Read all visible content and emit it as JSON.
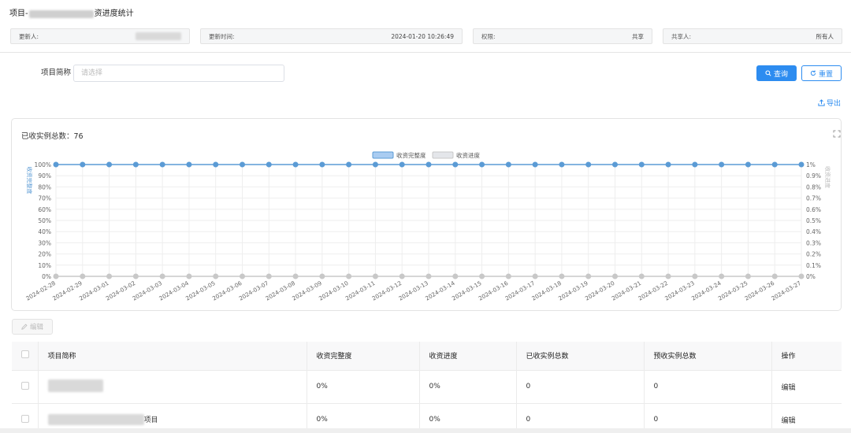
{
  "header": {
    "title_prefix": "项目-",
    "title_suffix": "资进度统计",
    "info": [
      {
        "label": "更新人:",
        "value": ""
      },
      {
        "label": "更新时间:",
        "value": "2024-01-20 10:26:49"
      },
      {
        "label": "权限:",
        "value": "共享"
      },
      {
        "label": "共享人:",
        "value": "所有人"
      }
    ]
  },
  "filter": {
    "label": "项目简称",
    "placeholder": "请选择",
    "query_label": "查询",
    "reset_label": "重置",
    "export_label": "导出"
  },
  "chart_summary": {
    "label": "已收实例总数：",
    "value": "76"
  },
  "edit_label": "编辑",
  "table": {
    "headers": [
      "项目简称",
      "收资完整度",
      "收资进度",
      "已收实例总数",
      "预收实例总数",
      "操作"
    ],
    "rows": [
      {
        "name_suffix": "",
        "completeness": "0%",
        "progress": "0%",
        "received": "0",
        "expected": "0",
        "action": "编辑"
      },
      {
        "name_suffix": "项目",
        "completeness": "0%",
        "progress": "0%",
        "received": "0",
        "expected": "0",
        "action": "编辑"
      }
    ]
  },
  "colors": {
    "accent": "#2d8cf0",
    "series1": "#5b9bd5",
    "series2": "#c8c8c8"
  },
  "chart_data": {
    "type": "line",
    "x": [
      "2024-02-28",
      "2024-02-29",
      "2024-03-01",
      "2024-03-02",
      "2024-03-03",
      "2024-03-04",
      "2024-03-05",
      "2024-03-06",
      "2024-03-07",
      "2024-03-08",
      "2024-03-09",
      "2024-03-10",
      "2024-03-11",
      "2024-03-12",
      "2024-03-13",
      "2024-03-14",
      "2024-03-15",
      "2024-03-16",
      "2024-03-17",
      "2024-03-18",
      "2024-03-19",
      "2024-03-20",
      "2024-03-21",
      "2024-03-22",
      "2024-03-23",
      "2024-03-24",
      "2024-03-25",
      "2024-03-26",
      "2024-03-27"
    ],
    "series": [
      {
        "name": "收资完整度",
        "axis": "left",
        "values": [
          100,
          100,
          100,
          100,
          100,
          100,
          100,
          100,
          100,
          100,
          100,
          100,
          100,
          100,
          100,
          100,
          100,
          100,
          100,
          100,
          100,
          100,
          100,
          100,
          100,
          100,
          100,
          100,
          100
        ]
      },
      {
        "name": "收资进度",
        "axis": "right",
        "values": [
          0,
          0,
          0,
          0,
          0,
          0,
          0,
          0,
          0,
          0,
          0,
          0,
          0,
          0,
          0,
          0,
          0,
          0,
          0,
          0,
          0,
          0,
          0,
          0,
          0,
          0,
          0,
          0,
          0
        ]
      }
    ],
    "ylabel_left": "收资完整度",
    "ylabel_right": "收资进度",
    "yticks_left": [
      "0%",
      "10%",
      "20%",
      "30%",
      "40%",
      "50%",
      "60%",
      "70%",
      "80%",
      "90%",
      "100%"
    ],
    "yticks_right": [
      "0%",
      "0.1%",
      "0.2%",
      "0.3%",
      "0.4%",
      "0.5%",
      "0.6%",
      "0.7%",
      "0.8%",
      "0.9%",
      "1%"
    ],
    "ylim_left": [
      0,
      100
    ],
    "ylim_right": [
      0,
      1
    ],
    "legend_position": "top-center",
    "grid": true
  }
}
